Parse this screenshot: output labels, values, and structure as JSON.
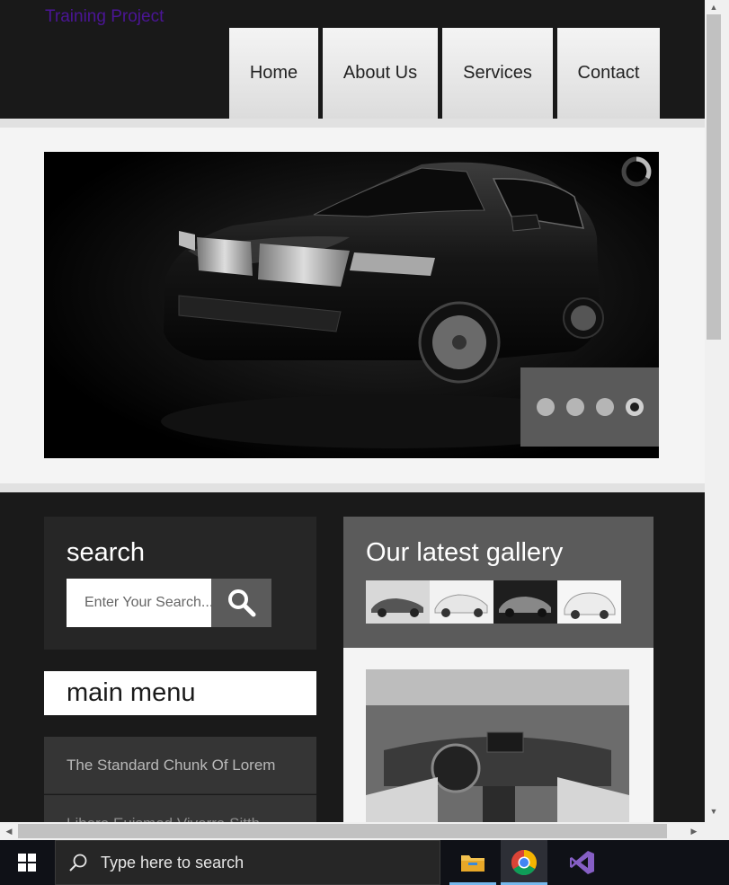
{
  "site": {
    "title": "Training Project"
  },
  "nav": {
    "items": [
      {
        "label": "Home"
      },
      {
        "label": "About Us"
      },
      {
        "label": "Services"
      },
      {
        "label": "Contact"
      }
    ]
  },
  "slider": {
    "dot_count": 4,
    "active_dot": 4
  },
  "search": {
    "title": "search",
    "placeholder": "Enter Your Search..."
  },
  "main_menu": {
    "title": "main menu",
    "items": [
      {
        "label": "The Standard Chunk Of Lorem"
      },
      {
        "label": "Libero Euismod Viverra Sitth"
      }
    ]
  },
  "gallery": {
    "title": "Our latest gallery",
    "thumbnail_count": 4
  },
  "taskbar": {
    "search_placeholder": "Type here to search",
    "apps": [
      "file-explorer",
      "chrome",
      "visual-studio"
    ]
  },
  "colors": {
    "header_bg": "#191919",
    "site_title": "#4b1596",
    "panel_dark": "#262626",
    "panel_gray": "#5b5b5b"
  }
}
